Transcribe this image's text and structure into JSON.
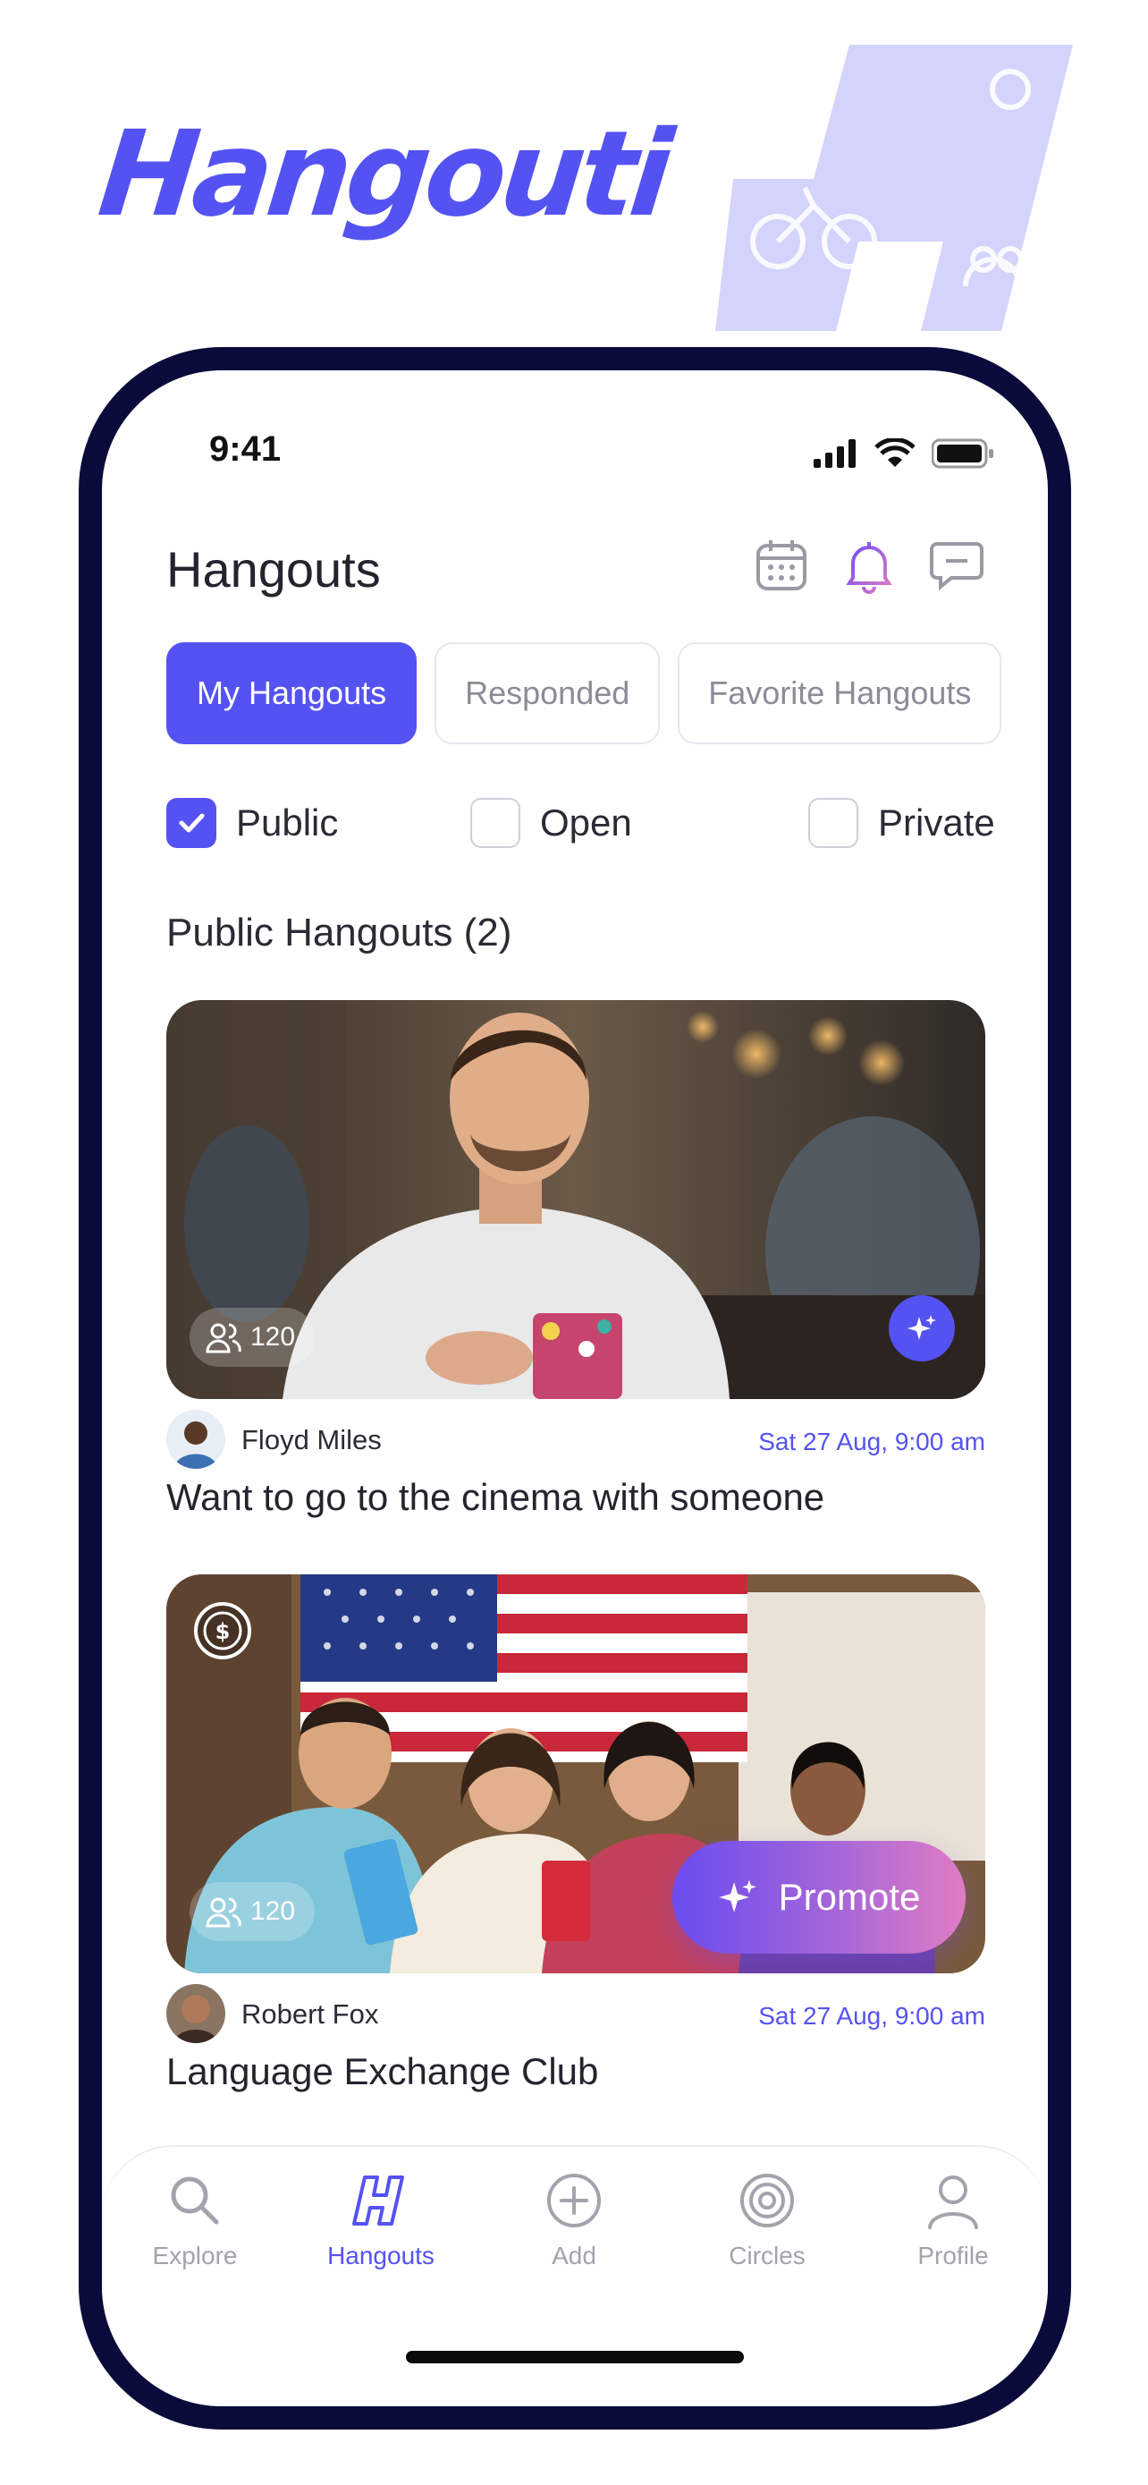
{
  "brand": {
    "name": "Hangouti",
    "color": "#5552f2"
  },
  "status_bar": {
    "time": "9:41"
  },
  "header": {
    "title": "Hangouts",
    "icons": [
      "calendar-icon",
      "bell-icon",
      "chat-icon"
    ]
  },
  "tabs": [
    {
      "label": "My Hangouts",
      "active": true
    },
    {
      "label": "Responded",
      "active": false
    },
    {
      "label": "Favorite Hangouts",
      "active": false
    }
  ],
  "filters": [
    {
      "label": "Public",
      "checked": true
    },
    {
      "label": "Open",
      "checked": false
    },
    {
      "label": "Private",
      "checked": false
    }
  ],
  "section": {
    "title": "Public Hangouts (2)"
  },
  "hangouts": [
    {
      "attendees": "120",
      "author": "Floyd Miles",
      "date": "Sat 27 Aug, 9:00 am",
      "title": "Want to go to the cinema with someone"
    },
    {
      "attendees": "120",
      "author": "Robert Fox",
      "date": "Sat 27 Aug, 9:00 am",
      "title": "Language Exchange Club",
      "promote_label": "Promote"
    }
  ],
  "bottom_nav": [
    {
      "label": "Explore",
      "icon": "explore-icon",
      "active": false
    },
    {
      "label": "Hangouts",
      "icon": "hangouts-icon",
      "active": true
    },
    {
      "label": "Add",
      "icon": "add-icon",
      "active": false
    },
    {
      "label": "Circles",
      "icon": "circles-icon",
      "active": false
    },
    {
      "label": "Profile",
      "icon": "profile-icon",
      "active": false
    }
  ],
  "colors": {
    "accent": "#5552f2",
    "frame": "#0b0b3b",
    "muted": "#a3a3ad"
  }
}
